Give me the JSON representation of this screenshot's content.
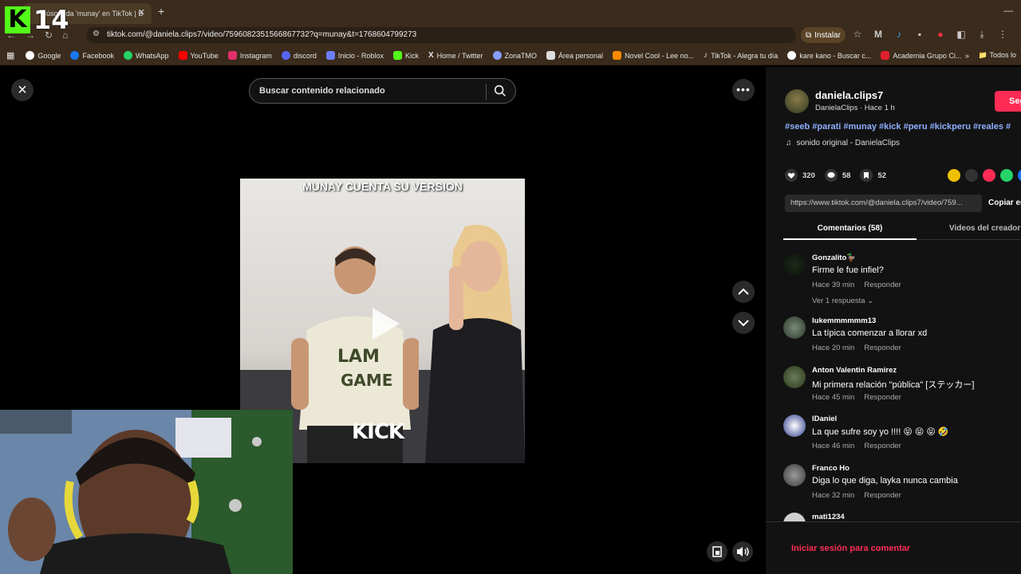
{
  "browser": {
    "tab_title": "Búsqueda 'munay' en TikTok | B",
    "url": "tiktok.com/@daniela.clips7/video/7596082351566867732?q=munay&t=1768604799273",
    "install_label": "Instalar",
    "bookmarks": [
      {
        "label": "Google",
        "color": "#ffffff"
      },
      {
        "label": "Facebook",
        "color": "#1877f2"
      },
      {
        "label": "WhatsApp",
        "color": "#25d366"
      },
      {
        "label": "YouTube",
        "color": "#ff0000"
      },
      {
        "label": "Instagram",
        "color": "#e1306c"
      },
      {
        "label": "discord",
        "color": "#5865f2"
      },
      {
        "label": "Inicio - Roblox",
        "color": "#6b7fff"
      },
      {
        "label": "Kick",
        "color": "#53fc18"
      },
      {
        "label": "Home / Twitter",
        "color": "#ffffff"
      },
      {
        "label": "ZonaTMO",
        "color": "#8a9eff"
      },
      {
        "label": "Área personal",
        "color": "#dddddd"
      },
      {
        "label": "Novel Cool - Lee no...",
        "color": "#ff8a00"
      },
      {
        "label": "TikTok - Alegra tu día",
        "color": "#ffffff"
      },
      {
        "label": "kare kano - Buscar c...",
        "color": "#ffffff"
      },
      {
        "label": "Academia Grupo Ci...",
        "color": "#e0202a"
      }
    ],
    "all_bookmarks": "Todos lo"
  },
  "overlay": {
    "channel_number": "14"
  },
  "viewer": {
    "search_placeholder": "Buscar contenido relacionado",
    "video_caption": "MUNAY CUENTA SU VERSION",
    "video_watermark": "KICK"
  },
  "panel": {
    "username": "daniela.clips7",
    "subline": "DanielaClips · Hace 1 h",
    "follow_label": "Seg",
    "hashtags": "#seeb #parati #munay #kick #peru #kickperu #reales #",
    "sound": "sonido original - DanielaClips",
    "likes": "320",
    "comments_count": "58",
    "saves": "52",
    "link": "https://www.tiktok.com/@daniela.clips7/video/759...",
    "copy_label": "Copiar en",
    "tab_comments": "Comentarios (58)",
    "tab_creator": "Videos del creador",
    "login_prompt": "Iniciar sesión para comentar",
    "comment_list": [
      {
        "user": "Gonzalito🦆",
        "text": "Firme le fue infiel?",
        "time": "Hace 39 min",
        "reply": "Responder",
        "more": "Ver 1 respuesta ⌄"
      },
      {
        "user": "lukemmmmmm13",
        "text": "La típica comenzar a llorar xd",
        "time": "Hace 20 min",
        "reply": "Responder"
      },
      {
        "user": "Anton Valentin Ramirez",
        "text": "Mi primera relación \"pública\" [ステッカー]",
        "time": "Hace 45 min",
        "reply": "Responder"
      },
      {
        "user": "lDaniel",
        "text": "La que sufre soy yo !!!! 😝 😝 😝 🤣",
        "time": "Hace 46 min",
        "reply": "Responder"
      },
      {
        "user": "Franco Ho",
        "text": "Diga lo que diga, layka nunca cambia",
        "time": "Hace 32 min",
        "reply": "Responder"
      },
      {
        "user": "mati1234",
        "text": "",
        "time": "",
        "reply": ""
      }
    ]
  }
}
